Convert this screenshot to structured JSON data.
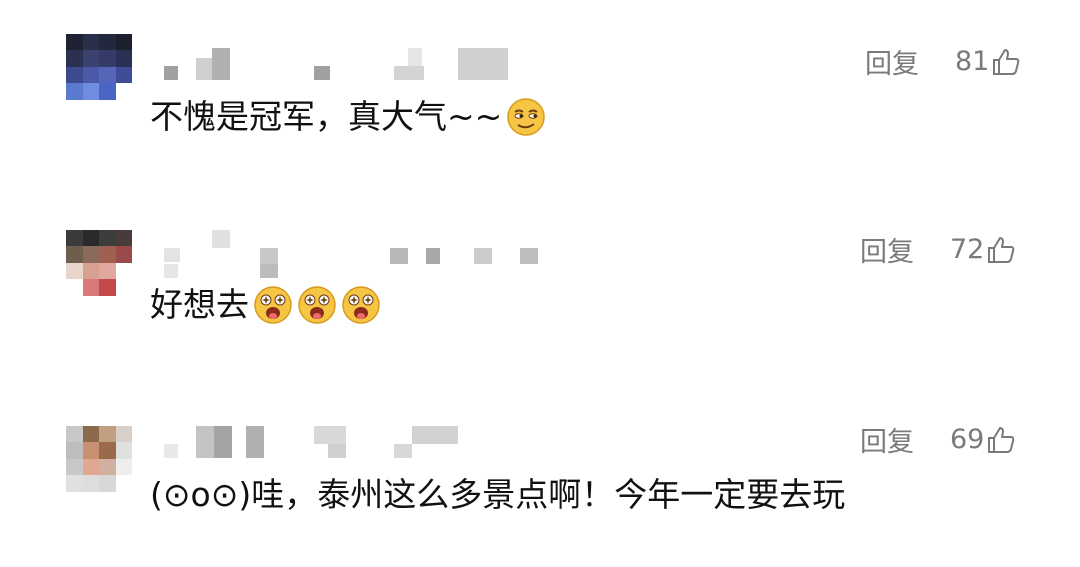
{
  "comments": [
    {
      "text": "不愧是冠军，真大气~~",
      "emojis": [
        "smirk-face-icon"
      ],
      "reply_label": "回复",
      "likes": "81",
      "avatar_colors": [
        "#1e2233",
        "#2a2f4a",
        "#23283f",
        "#1b1f2e",
        "#2b3152",
        "#3a4270",
        "#353b68",
        "#2a2f55",
        "#3c4b8f",
        "#4b5aa8",
        "#5565b8",
        "#3f4d96",
        "#5a7ad0",
        "#6f8de0",
        "#4a66c4",
        "#ffffff",
        "#ffffff",
        "#ffffff",
        "#ffffff",
        "#ffffff"
      ]
    },
    {
      "text": "好想去",
      "emojis": [
        "starry-eyed-face-icon",
        "starry-eyed-face-icon",
        "starry-eyed-face-icon"
      ],
      "reply_label": "回复",
      "likes": "72",
      "avatar_colors": [
        "#3b3b3b",
        "#2a2a2a",
        "#3d3d3d",
        "#4a3b3b",
        "#6e5e4e",
        "#8a6a5a",
        "#a06050",
        "#9a4a4a",
        "#e8d6cc",
        "#d8a090",
        "#e0a8a0",
        "#ffffff",
        "#ffffff",
        "#d87a7a",
        "#c24a4a",
        "#ffffff",
        "#ffffff",
        "#ffffff",
        "#ffffff",
        "#ffffff"
      ]
    },
    {
      "text": "(⊙o⊙)哇，泰州这么多景点啊！今年一定要去玩",
      "emojis": [],
      "reply_label": "回复",
      "likes": "69",
      "avatar_colors": [
        "#c8c8c8",
        "#8a6a4a",
        "#c0a080",
        "#d8d0c8",
        "#bdbdbd",
        "#c89070",
        "#9a6a4a",
        "#e0e0e0",
        "#c8c8c8",
        "#e0a890",
        "#d0b0a0",
        "#eeeeee",
        "#e0e0e0",
        "#dddddd",
        "#d8d8d8",
        "#ffffff",
        "#ffffff",
        "#ffffff",
        "#ffffff",
        "#ffffff"
      ]
    }
  ],
  "colors": {
    "text": "#111111",
    "meta": "#7a7a7a",
    "mosaic_dark": "#9a9a9a",
    "mosaic_light": "#d8d8d8"
  }
}
